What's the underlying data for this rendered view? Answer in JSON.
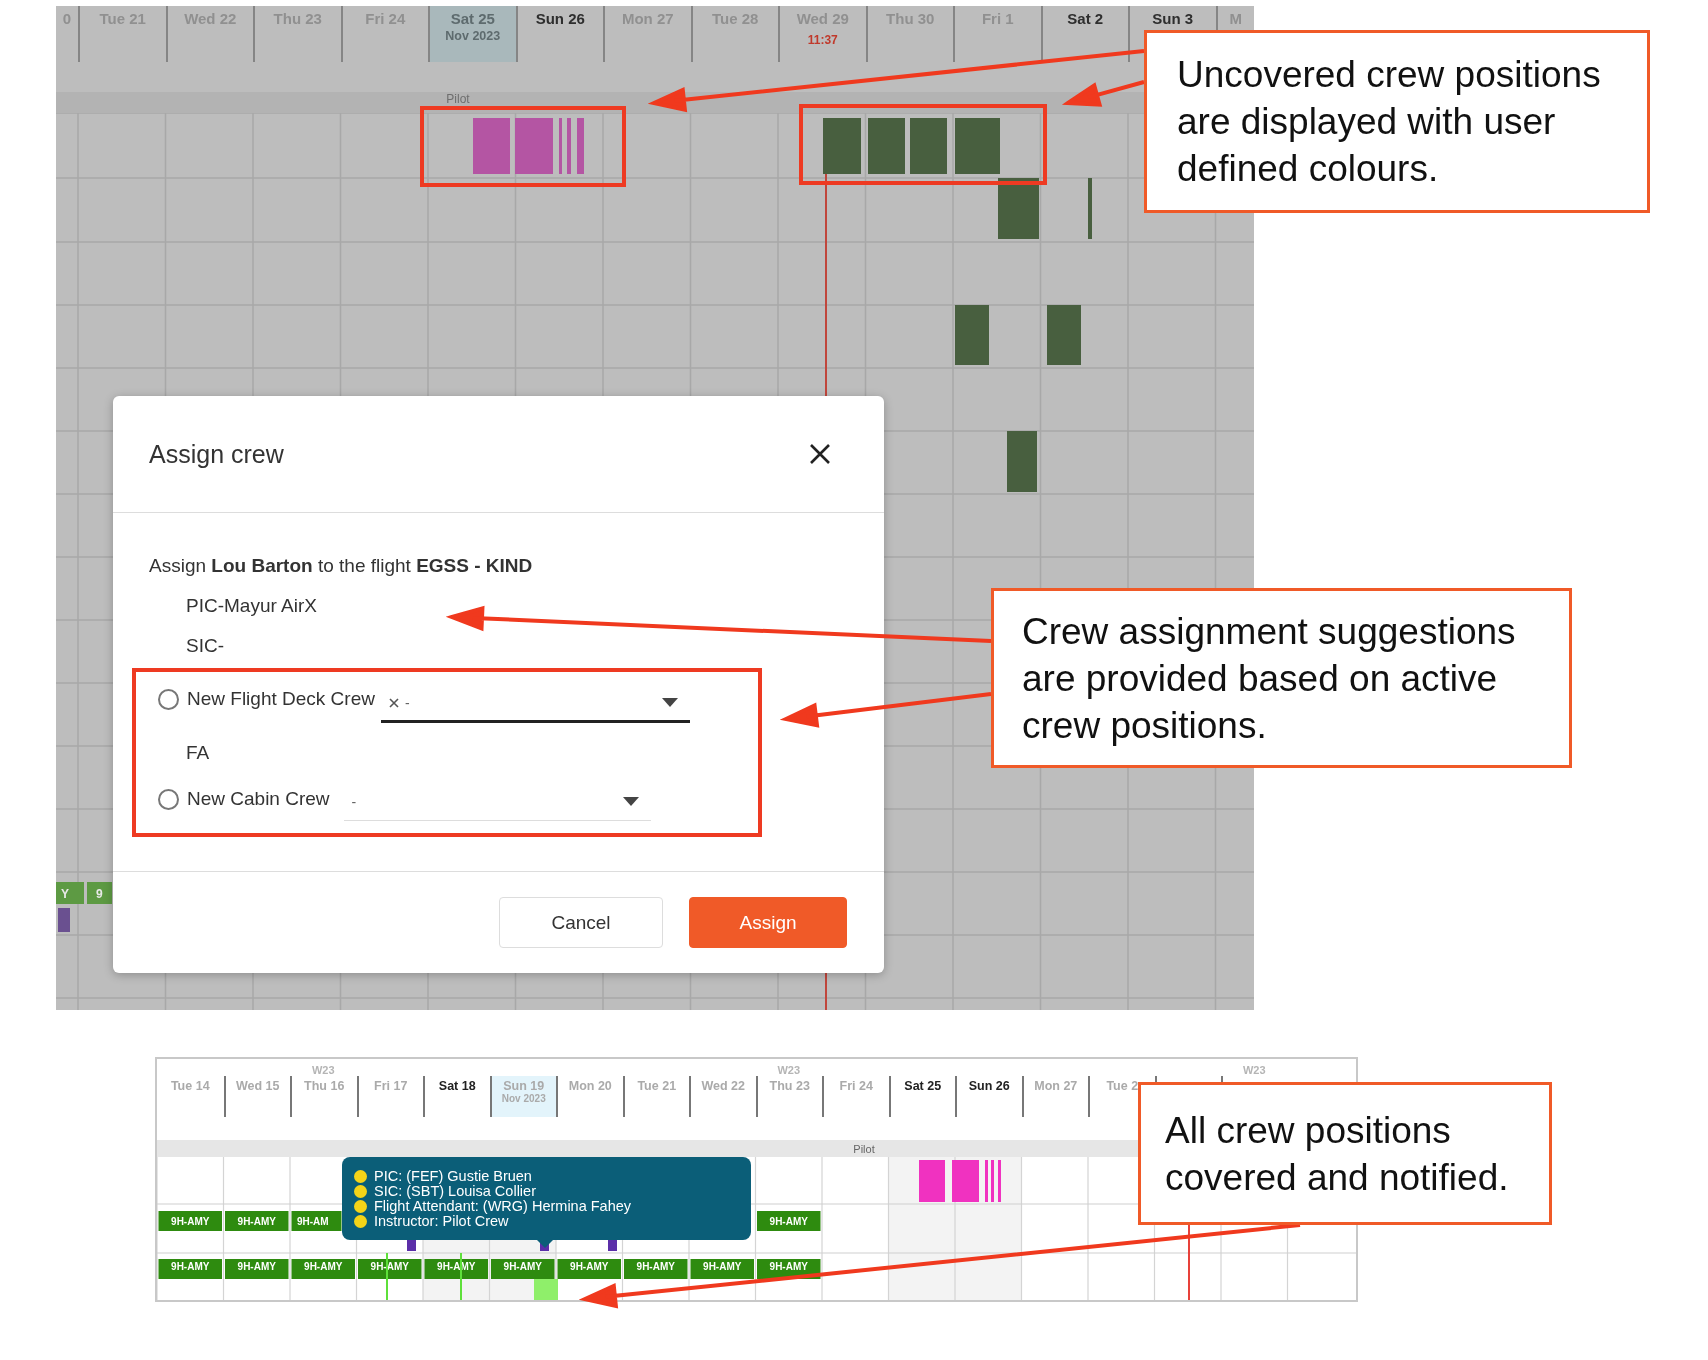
{
  "top_schedule": {
    "left_partial_day": "0",
    "days": [
      {
        "label": "Tue 21",
        "kind": "plain"
      },
      {
        "label": "Wed 22",
        "kind": "plain"
      },
      {
        "label": "Thu 23",
        "kind": "plain"
      },
      {
        "label": "Fri 24",
        "kind": "plain"
      },
      {
        "label": "Sat 25",
        "kind": "today",
        "sub": "Nov 2023"
      },
      {
        "label": "Sun 26",
        "kind": "bold"
      },
      {
        "label": "Mon 27",
        "kind": "plain"
      },
      {
        "label": "Tue 28",
        "kind": "plain"
      },
      {
        "label": "Wed 29",
        "kind": "plain",
        "time": "11:37"
      },
      {
        "label": "Thu 30",
        "kind": "plain"
      },
      {
        "label": "Fri 1",
        "kind": "plain"
      },
      {
        "label": "Sat 2",
        "kind": "bold"
      },
      {
        "label": "Sun 3",
        "kind": "bold"
      }
    ],
    "right_partial_day": "M",
    "group_label": "Pilot",
    "edge_labels": [
      "Y",
      "9"
    ]
  },
  "dialog": {
    "title": "Assign crew",
    "sentence": "Assign **Lou Barton** to the flight **EGSS - KIND**",
    "positions": [
      "PIC-Mayur AirX",
      "SIC-"
    ],
    "options": [
      {
        "label": "New Flight Deck Crew",
        "selected": false,
        "value": "-",
        "clearable": true,
        "focused": true
      },
      {
        "section_label": "FA",
        "label": "New Cabin Crew",
        "selected": false,
        "value": "-",
        "clearable": false,
        "focused": false
      }
    ],
    "buttons": [
      {
        "label": "Cancel",
        "kind": "secondary"
      },
      {
        "label": "Assign",
        "kind": "primary"
      }
    ]
  },
  "bottom_schedule": {
    "days": [
      {
        "label": "Tue 14",
        "kind": "plain"
      },
      {
        "label": "Wed 15",
        "kind": "plain"
      },
      {
        "label": "Thu 16",
        "kind": "plain",
        "week": "W23"
      },
      {
        "label": "Fri 17",
        "kind": "plain"
      },
      {
        "label": "Sat 18",
        "kind": "bold"
      },
      {
        "label": "Sun 19",
        "kind": "today",
        "sub": "Nov 2023"
      },
      {
        "label": "Mon 20",
        "kind": "plain"
      },
      {
        "label": "Tue 21",
        "kind": "plain"
      },
      {
        "label": "Wed 22",
        "kind": "plain"
      },
      {
        "label": "Thu 23",
        "kind": "plain",
        "week": "W23"
      },
      {
        "label": "Fri 24",
        "kind": "plain"
      },
      {
        "label": "Sat 25",
        "kind": "bold"
      },
      {
        "label": "Sun 26",
        "kind": "bold"
      },
      {
        "label": "Mon 27",
        "kind": "plain"
      },
      {
        "label": "Tue 2",
        "kind": "plain"
      }
    ],
    "extra_week_label": "W23",
    "group_label": "Pilot",
    "aircraft_row_1": [
      "9H-AMY",
      "9H-AMY",
      "9H-AM",
      "9H-AMY"
    ],
    "aircraft_row_2": [
      "9H-AMY",
      "9H-AMY",
      "9H-AMY",
      "9H-AMY",
      "9H-AMY",
      "9H-AMY",
      "9H-AMY",
      "9H-AMY",
      "9H-AMY",
      "9H-AMY"
    ],
    "tooltip": {
      "lines": [
        "PIC: (FEF) Gustie Bruen",
        "SIC: (SBT) Louisa Collier",
        "Flight Attendant: (WRG) Hermina Fahey",
        "Instructor: Pilot Crew"
      ]
    }
  },
  "callouts": [
    "Uncovered crew positions are displayed with user defined colours.",
    "Crew assignment suggestions are provided based on active crew positions.",
    "All crew positions covered and notified."
  ]
}
